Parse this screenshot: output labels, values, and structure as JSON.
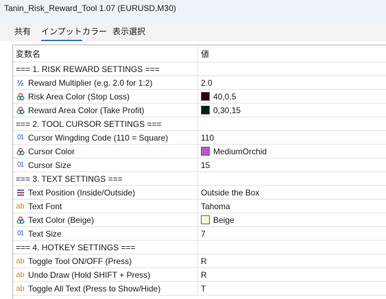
{
  "window": {
    "title": "Tanin_Risk_Reward_Tool 1.07 (EURUSD,M30)"
  },
  "tabs": [
    {
      "label": "共有",
      "active": false
    },
    {
      "label": "インプット",
      "active": true
    },
    {
      "label": "カラー",
      "active": false
    },
    {
      "label": "表示選択",
      "active": false
    }
  ],
  "table": {
    "col_name": "変数名",
    "col_value": "値",
    "rows": [
      {
        "type": "section",
        "name": "=== 1. RISK REWARD SETTINGS ===",
        "value": ""
      },
      {
        "type": "param",
        "icon": "fraction-icon",
        "name": "Reward Multiplier (e.g. 2.0 for 1:2)",
        "value": "2.0"
      },
      {
        "type": "param",
        "icon": "color-palette-icon",
        "name": "Risk Area Color (Stop Loss)",
        "value": "40,0,5",
        "swatch": "#28000a"
      },
      {
        "type": "param",
        "icon": "color-palette-icon",
        "name": "Reward Area Color (Take Profit)",
        "value": "0,30,15",
        "swatch": "#001e0f"
      },
      {
        "type": "section",
        "name": "=== 2. TOOL CURSOR SETTINGS ===",
        "value": ""
      },
      {
        "type": "param",
        "icon": "integer-icon",
        "name": "Cursor Wingding Code (110 = Square)",
        "value": "110"
      },
      {
        "type": "param",
        "icon": "color-palette-icon",
        "name": "Cursor Color",
        "value": "MediumOrchid",
        "swatch": "#ba55d3"
      },
      {
        "type": "param",
        "icon": "integer-icon",
        "name": "Cursor Size",
        "value": "15"
      },
      {
        "type": "section",
        "name": "=== 3. TEXT SETTINGS ===",
        "value": ""
      },
      {
        "type": "param",
        "icon": "enum-list-icon",
        "name": "Text Position (Inside/Outside)",
        "value": "Outside the Box"
      },
      {
        "type": "param",
        "icon": "string-ab-icon",
        "name": "Text Font",
        "value": "Tahoma"
      },
      {
        "type": "param",
        "icon": "color-palette-icon",
        "name": "Text Color (Beige)",
        "value": "Beige",
        "swatch": "#f5f5dc"
      },
      {
        "type": "param",
        "icon": "integer-icon",
        "name": "Text Size",
        "value": "7"
      },
      {
        "type": "section",
        "name": "=== 4. HOTKEY SETTINGS ===",
        "value": ""
      },
      {
        "type": "param",
        "icon": "string-ab-icon",
        "name": "Toggle Tool ON/OFF (Press)",
        "value": "R"
      },
      {
        "type": "param",
        "icon": "string-ab-icon",
        "name": "Undo Draw (Hold SHIFT + Press)",
        "value": "R"
      },
      {
        "type": "param",
        "icon": "string-ab-icon",
        "name": "Toggle All Text (Press to Show/Hide)",
        "value": "T"
      }
    ]
  }
}
